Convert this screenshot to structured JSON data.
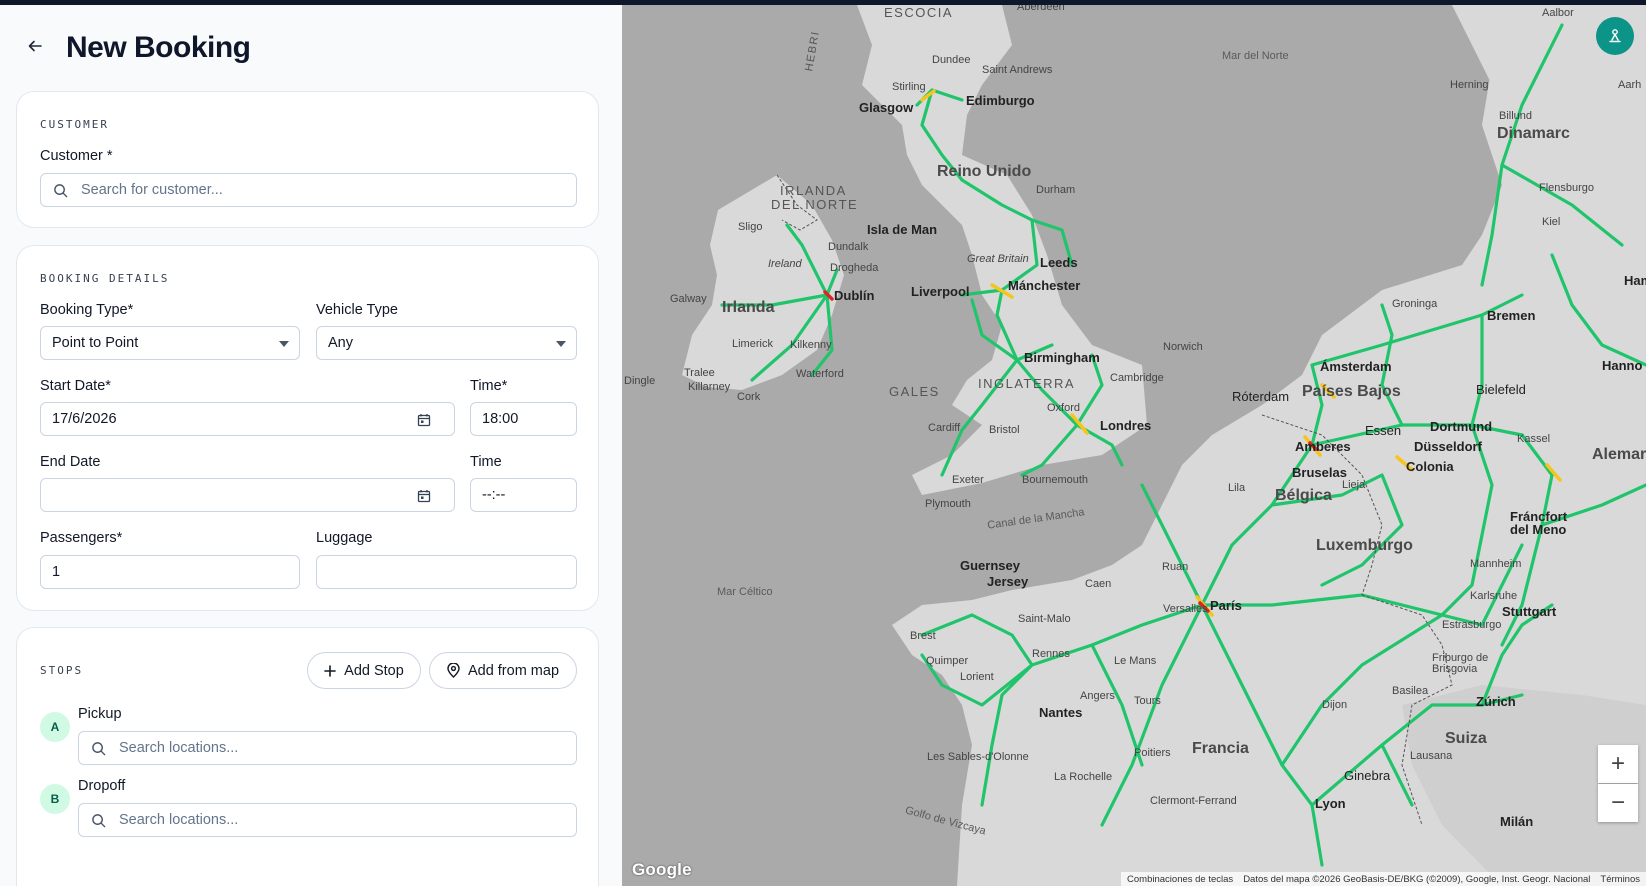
{
  "page": {
    "title": "New Booking"
  },
  "customer": {
    "section_label": "CUSTOMER",
    "field_label": "Customer *",
    "placeholder": "Search for customer..."
  },
  "booking": {
    "section_label": "BOOKING DETAILS",
    "booking_type_label": "Booking Type*",
    "booking_type_value": "Point to Point",
    "vehicle_type_label": "Vehicle Type",
    "vehicle_type_value": "Any",
    "start_date_label": "Start Date*",
    "start_date_value": "17/6/2026",
    "start_time_label": "Time*",
    "start_time_value": "18:00",
    "end_date_label": "End Date",
    "end_date_value": "",
    "end_time_label": "Time",
    "end_time_value": "--:--",
    "passengers_label": "Passengers*",
    "passengers_value": "1",
    "luggage_label": "Luggage",
    "luggage_value": ""
  },
  "stops": {
    "section_label": "STOPS",
    "add_stop_label": "Add Stop",
    "add_from_map_label": "Add from map",
    "items": [
      {
        "badge": "A",
        "label": "Pickup",
        "placeholder": "Search locations..."
      },
      {
        "badge": "B",
        "label": "Dropoff",
        "placeholder": "Search locations..."
      }
    ]
  },
  "map": {
    "labels": {
      "escocia": "ESCOCIA",
      "aberdeen": "Aberdeen",
      "hebri": "HEBRI",
      "mar_norte": "Mar del Norte",
      "dundee": "Dundee",
      "saint_andrews": "Saint Andrews",
      "stirling": "Stirling",
      "glasgow": "Glasgow",
      "edimburgo": "Edimburgo",
      "reino_unido": "Reino Unido",
      "durham": "Durham",
      "irlanda_norte_1": "IRLANDA",
      "irlanda_norte_2": "DEL NORTE",
      "isla_man": "Isla de Man",
      "sligo": "Sligo",
      "dundalk": "Dundalk",
      "ireland": "Ireland",
      "drogheda": "Drogheda",
      "great_britain": "Great Britain",
      "leeds": "Leeds",
      "galway": "Galway",
      "irlanda": "Irlanda",
      "dublin": "Dublín",
      "liverpool": "Liverpool",
      "manchester": "Mánchester",
      "groninga": "Groninga",
      "bremen": "Bremen",
      "norwich": "Norwich",
      "limerick": "Limerick",
      "kilkenny": "Kilkenny",
      "birmingham": "Birmingham",
      "amsterdam": "Ámsterdam",
      "hanno": "Hanno",
      "tralee": "Tralee",
      "waterford": "Waterford",
      "cambridge": "Cambridge",
      "dingle": "Dingle",
      "killarney": "Killarney",
      "gales": "GALES",
      "inglaterra": "INGLATERRA",
      "roterdam": "Róterdam",
      "paises_bajos": "Países Bajos",
      "bielefeld": "Bielefeld",
      "cork": "Cork",
      "oxford": "Oxford",
      "essen": "Essen",
      "dortmund": "Dortmund",
      "cardiff": "Cardiff",
      "bristol": "Bristol",
      "londres": "Londres",
      "amberes": "Amberes",
      "dusseldorf": "Düsseldorf",
      "kassel": "Kassel",
      "aleman": "Alemar",
      "bruselas": "Bruselas",
      "colonia": "Colonia",
      "exeter": "Exeter",
      "bournemouth": "Bournemouth",
      "lila": "Lila",
      "lieja": "Lieja",
      "belgica": "Bélgica",
      "plymouth": "Plymouth",
      "canal_mancha": "Canal de la Mancha",
      "francfort_1": "Fráncfort",
      "francfort_2": "del Meno",
      "luxemburgo": "Luxemburgo",
      "guernsey": "Guernsey",
      "jersey": "Jersey",
      "ruan": "Ruan",
      "mannheim": "Mannheim",
      "caen": "Caen",
      "mar_celtico": "Mar Céltico",
      "karlsruhe": "Karlsruhe",
      "versalles": "Versalles",
      "paris": "París",
      "stuttgart": "Stuttgart",
      "saint_malo": "Saint-Malo",
      "brest": "Brest",
      "estrasburgo": "Estrasburgo",
      "rennes": "Rennes",
      "quimper": "Quimper",
      "le_mans": "Le Mans",
      "friburgo_1": "Friburgo de",
      "friburgo_2": "Brisgovia",
      "lorient": "Lorient",
      "basilea": "Basilea",
      "angers": "Angers",
      "tours": "Tours",
      "zurich": "Zúrich",
      "nantes": "Nantes",
      "dijon": "Dijon",
      "francia": "Francia",
      "suiza": "Suiza",
      "poitiers": "Poitiers",
      "lausana": "Lausana",
      "sables": "Les Sables-d'Olonne",
      "la_rochelle": "La Rochelle",
      "ginebra": "Ginebra",
      "clermont": "Clermont-Ferrand",
      "lyon": "Lyon",
      "golfo_vizcaya": "Golfo de Vizcaya",
      "milan": "Milán",
      "dinamarca": "Dinamarc",
      "aalborg": "Aalbor",
      "herning": "Herning",
      "billund": "Billund",
      "aarh": "Aarh",
      "flensburgo": "Flensburgo",
      "kiel": "Kiel",
      "hamb": "Ham"
    },
    "google_logo": "Google",
    "attribution": {
      "shortcuts": "Combinaciones de teclas",
      "data": "Datos del mapa ©2026 GeoBasis-DE/BKG (©2009), Google, Inst. Geogr. Nacional",
      "terms": "Términos"
    },
    "zoom_in": "+",
    "zoom_out": "−"
  },
  "colors": {
    "accent": "#0d9488",
    "traffic_green": "#22c55e",
    "traffic_yellow": "#facc15",
    "traffic_red": "#dc2626",
    "land": "#d9d9d9",
    "sea": "#aaaaaa"
  }
}
